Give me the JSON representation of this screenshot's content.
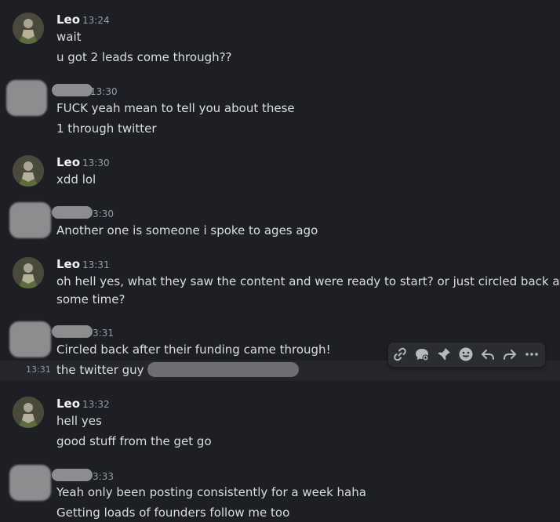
{
  "messages": [
    {
      "author": "Leo",
      "time": "13:24",
      "lines": [
        "wait",
        "u got 2 leads come through??"
      ]
    },
    {
      "author": "",
      "time": "13:30",
      "lines": [
        "FUCK yeah mean to tell you about these",
        "1 through twitter"
      ]
    },
    {
      "author": "Leo",
      "time": "13:30",
      "lines": [
        "xdd lol"
      ]
    },
    {
      "author": "",
      "time": "3:30",
      "lines": [
        "Another one is someone i spoke to ages ago"
      ]
    },
    {
      "author": "Leo",
      "time": "13:31",
      "lines": [
        "oh hell yes, what they saw the content and were ready to start? or just circled back after",
        "some time?"
      ]
    },
    {
      "author": "",
      "time": "3:31",
      "lines": [
        "Circled back after their funding came through!"
      ]
    },
    {
      "author": "",
      "time": "13:31",
      "lines": [
        "the twitter guy is"
      ]
    },
    {
      "author": "Leo",
      "time": "13:32",
      "lines": [
        "hell yes",
        "good stuff from the get go"
      ]
    },
    {
      "author": "",
      "time": "3:33",
      "lines": [
        "Yeah only been posting consistently for a week haha",
        "Getting loads of founders follow me too"
      ]
    }
  ],
  "toolbar": {
    "icons": [
      "link-icon",
      "thread-icon",
      "pin-icon",
      "emoji-icon",
      "reply-icon",
      "forward-icon",
      "more-icon"
    ]
  },
  "colors": {
    "background": "#1e1f24",
    "text": "#dbdee1",
    "muted": "#949ba4",
    "username": "#f2f3f5",
    "toolbar_bg": "#2b2d31"
  }
}
